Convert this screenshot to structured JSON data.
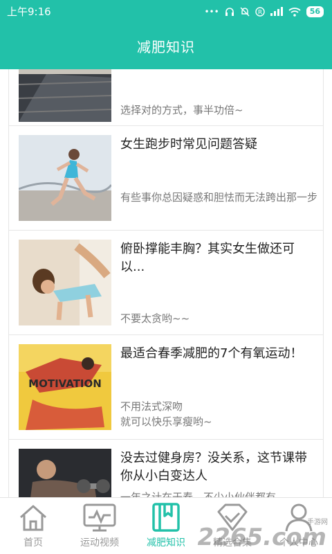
{
  "status_bar": {
    "time": "上午9:16",
    "battery": "56"
  },
  "header": {
    "title": "减肥知识"
  },
  "articles": [
    {
      "title": "",
      "desc": "选择对的方式，事半功倍~"
    },
    {
      "title": "女生跑步时常见问题答疑",
      "desc": "有些事你总因疑惑和胆怯而无法跨出那一步"
    },
    {
      "title": "俯卧撑能丰胸？其实女生做还可以...",
      "desc": "不要太贪哟~~"
    },
    {
      "title": "最适合春季减肥的7个有氧运动！",
      "desc": "不用法式深吻\n就可以快乐享瘦哟~",
      "thumb_text": "MOTIVATION"
    },
    {
      "title": "没去过健身房？没关系，这节课带你从小白变达人",
      "desc": "一年之计在于春，不少小伙伴都有"
    }
  ],
  "tabs": [
    {
      "label": "首页",
      "icon": "home-icon"
    },
    {
      "label": "运动视频",
      "icon": "monitor-icon"
    },
    {
      "label": "减肥知识",
      "icon": "book-icon",
      "active": true
    },
    {
      "label": "精选合集",
      "icon": "diamond-icon"
    },
    {
      "label": "个人中心",
      "icon": "person-icon"
    }
  ],
  "watermark": {
    "text": "2265.com",
    "small": "手游网"
  },
  "colors": {
    "accent": "#22c1a9"
  }
}
